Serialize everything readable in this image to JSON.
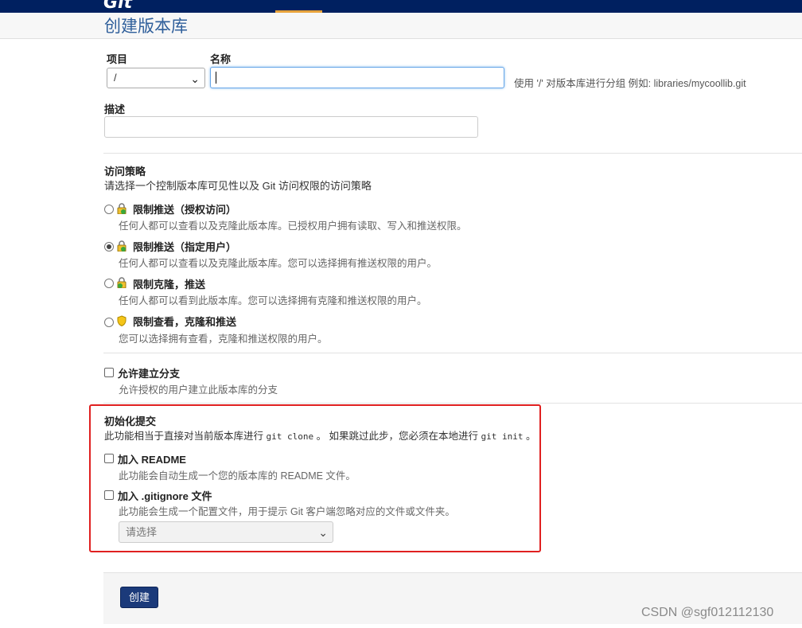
{
  "header": {
    "logo_text": "Git",
    "page_title": "创建版本库"
  },
  "form": {
    "project_label": "项目",
    "project_value": "/",
    "name_label": "名称",
    "name_value": "",
    "name_hint_prefix": "使用 '/' 对版本库进行分组 例如: ",
    "name_hint_example": "libraries/mycoollib.git",
    "description_label": "描述",
    "description_value": ""
  },
  "access_policy": {
    "title": "访问策略",
    "description": "请选择一个控制版本库可见性以及 Git 访问权限的访问策略",
    "options": [
      {
        "label": "限制推送（授权访问）",
        "description": "任何人都可以查看以及克隆此版本库。已授权用户拥有读取、写入和推送权限。",
        "checked": false,
        "icon": "lock-green-icon"
      },
      {
        "label": "限制推送（指定用户）",
        "description": "任何人都可以查看以及克隆此版本库。您可以选择拥有推送权限的用户。",
        "checked": true,
        "icon": "lock-green-icon"
      },
      {
        "label": "限制克隆，推送",
        "description": "任何人都可以看到此版本库。您可以选择拥有克隆和推送权限的用户。",
        "checked": false,
        "icon": "lock-green-icon"
      },
      {
        "label": "限制查看，克隆和推送",
        "description": "您可以选择拥有查看，克隆和推送权限的用户。",
        "checked": false,
        "icon": "shield-yellow-icon"
      }
    ]
  },
  "allow_fork": {
    "label": "允许建立分支",
    "description": "允许授权的用户建立此版本库的分支",
    "checked": false
  },
  "init_commit": {
    "title": "初始化提交",
    "desc_part1": "此功能相当于直接对当前版本库进行 ",
    "desc_code1": "git clone",
    "desc_part2": " 。 如果跳过此步，您必须在本地进行 ",
    "desc_code2": "git init",
    "desc_part3": " 。",
    "readme_label": "加入 README",
    "readme_desc": "此功能会自动生成一个您的版本库的 README 文件。",
    "readme_checked": false,
    "gitignore_label": "加入 .gitignore 文件",
    "gitignore_desc": "此功能会生成一个配置文件，用于提示 Git 客户端忽略对应的文件或文件夹。",
    "gitignore_checked": false,
    "gitignore_select_value": "请选择"
  },
  "actions": {
    "create_label": "创建"
  },
  "watermark": "CSDN @sgf012112130",
  "colors": {
    "topbar": "#002060",
    "title": "#2f5f9b",
    "highlight_box": "#e02020",
    "create_button": "#1b3a7a"
  }
}
